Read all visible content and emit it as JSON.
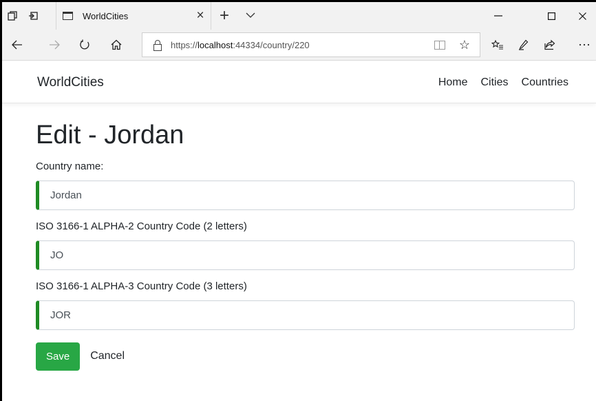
{
  "browser": {
    "tab_title": "WorldCities",
    "tab_close_glyph": "×",
    "new_tab_glyph": "+",
    "url_scheme": "https://",
    "url_host": "localhost",
    "url_rest": ":44334/country/220",
    "icons": {
      "tab_set_aside": "tab-set-aside-icon",
      "tab_preview": "tab-preview-icon",
      "back": "back-arrow-icon",
      "forward": "forward-arrow-icon",
      "refresh": "refresh-icon",
      "home": "home-icon",
      "lock": "lock-icon",
      "reading_view": "reading-view-icon",
      "favorite": "star-icon",
      "favorites_hub": "favorites-hub-icon",
      "notes": "pen-icon",
      "share": "share-icon",
      "more": "more-icon"
    }
  },
  "site": {
    "brand": "WorldCities",
    "nav": [
      {
        "label": "Home"
      },
      {
        "label": "Cities"
      },
      {
        "label": "Countries"
      }
    ]
  },
  "page": {
    "title": "Edit - Jordan",
    "fields": [
      {
        "label": "Country name:",
        "value": "Jordan"
      },
      {
        "label": "ISO 3166-1 ALPHA-2 Country Code (2 letters)",
        "value": "JO"
      },
      {
        "label": "ISO 3166-1 ALPHA-3 Country Code (3 letters)",
        "value": "JOR"
      }
    ],
    "save_label": "Save",
    "cancel_label": "Cancel"
  },
  "colors": {
    "accent_green": "#28a745",
    "valid_border": "#1f8b24"
  }
}
